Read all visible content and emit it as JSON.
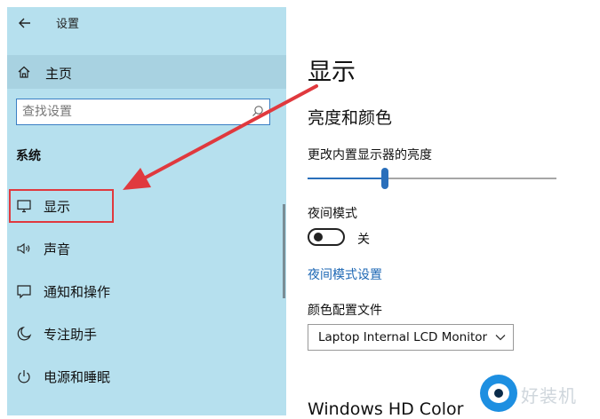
{
  "window": {
    "title": "设置"
  },
  "sidebar": {
    "home_label": "主页",
    "search": {
      "placeholder": "查找设置",
      "value": ""
    },
    "section_title": "系统",
    "items": [
      {
        "label": "显示",
        "icon": "monitor-icon"
      },
      {
        "label": "声音",
        "icon": "speaker-icon"
      },
      {
        "label": "通知和操作",
        "icon": "notification-icon"
      },
      {
        "label": "专注助手",
        "icon": "moon-icon"
      },
      {
        "label": "电源和睡眠",
        "icon": "power-icon"
      }
    ]
  },
  "main": {
    "title": "显示",
    "section": "亮度和颜色",
    "brightness_label": "更改内置显示器的亮度",
    "brightness_value": 0.31,
    "night_mode_label": "夜间模式",
    "night_mode_state": "关",
    "night_mode_settings_link": "夜间模式设置",
    "color_profile_label": "颜色配置文件",
    "color_profile_value": "Laptop Internal LCD Monitor",
    "cutoff_heading": "Windows HD Color"
  },
  "watermark": {
    "text": "好装机"
  },
  "colors": {
    "sidebar_bg": "#b6e0ee",
    "accent": "#2a6fbb",
    "annotation_red": "#e0393e",
    "link": "#1c67b4"
  }
}
